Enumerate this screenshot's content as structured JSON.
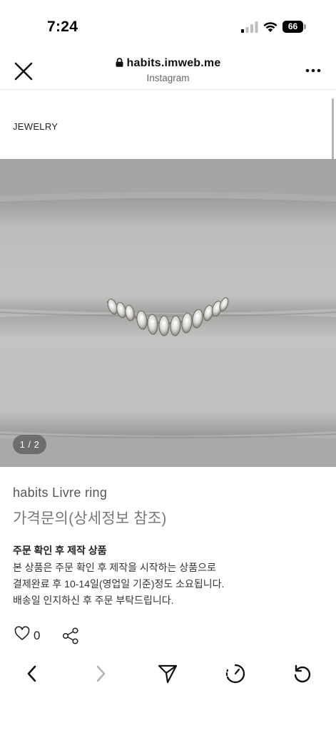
{
  "status_bar": {
    "time": "7:24",
    "battery": "66"
  },
  "browser": {
    "url": "habits.imweb.me",
    "source": "Instagram"
  },
  "page": {
    "category": "JEWELRY",
    "image_counter": "1 / 2"
  },
  "product": {
    "name": "habits Livre ring",
    "price": "가격문의(상세정보 참조)",
    "notice_title": "주문 확인 후 제작 상품",
    "notice_lines": [
      "본 상품은 주문 확인 후 제작을 시작하는 상품으로",
      "결제완료 후 10-14일(영업일 기준)정도 소요됩니다.",
      "배송일 인지하신 후 주문 부탁드립니다."
    ],
    "like_count": "0"
  },
  "icons": {
    "close": "close-icon",
    "lock": "lock-icon",
    "more": "more-icon",
    "heart": "heart-icon",
    "share": "share-icon",
    "back": "chevron-left-icon",
    "forward": "chevron-right-icon",
    "send": "send-icon",
    "timer": "timer-icon",
    "refresh": "refresh-icon"
  }
}
